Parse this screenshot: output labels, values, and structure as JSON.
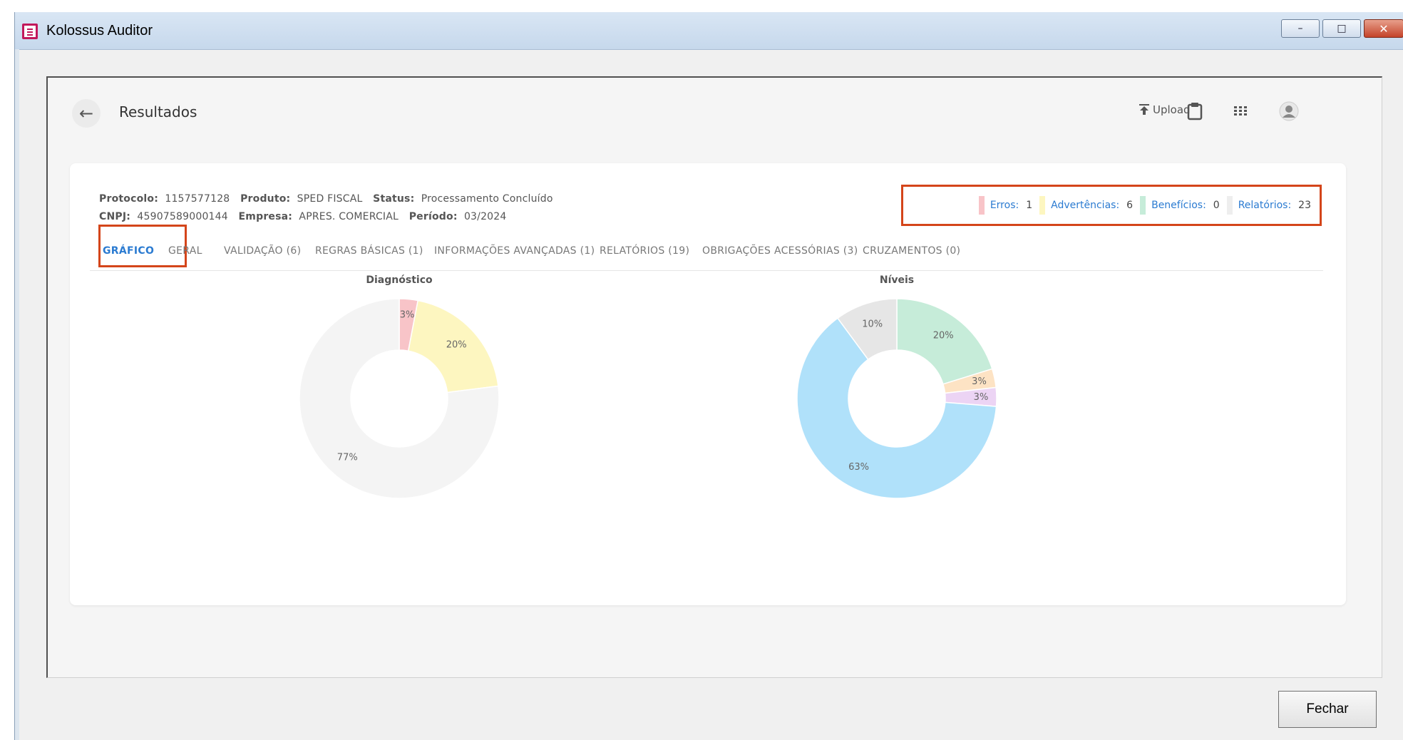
{
  "window": {
    "title": "Kolossus Auditor",
    "minimize_label": "–",
    "maximize_label": "□",
    "close_label": "✕",
    "close_button_label": "Fechar"
  },
  "header": {
    "back_icon": "←",
    "title": "Resultados",
    "upload_label": "Upload"
  },
  "info": {
    "protocolo_label": "Protocolo:",
    "protocolo": "1157577128",
    "produto_label": "Produto:",
    "produto": "SPED FISCAL",
    "status_label": "Status:",
    "status": "Processamento Concluído",
    "cnpj_label": "CNPJ:",
    "cnpj": "45907589000144",
    "empresa_label": "Empresa:",
    "empresa": "APRES. COMERCIAL",
    "periodo_label": "Período:",
    "periodo": "03/2024"
  },
  "summary": [
    {
      "label": "Erros:",
      "value": "1",
      "color": "#f8c4c8"
    },
    {
      "label": "Advertências:",
      "value": "6",
      "color": "#fdf6c0"
    },
    {
      "label": "Benefícios:",
      "value": "0",
      "color": "#c6ecd9"
    },
    {
      "label": "Relatórios:",
      "value": "23",
      "color": "#eeeeee"
    }
  ],
  "tabs": [
    {
      "label": "GRÁFICO",
      "active": true
    },
    {
      "label": "GERAL"
    },
    {
      "label": "VALIDAÇÃO (6)"
    },
    {
      "label": "REGRAS BÁSICAS (1)"
    },
    {
      "label": "INFORMAÇÕES AVANÇADAS (1)"
    },
    {
      "label": "RELATÓRIOS (19)"
    },
    {
      "label": "OBRIGAÇÕES ACESSÓRIAS (3)"
    },
    {
      "label": "CRUZAMENTOS (0)"
    }
  ],
  "chart_data": [
    {
      "type": "pie",
      "title": "Diagnóstico",
      "slices": [
        {
          "label": "3%",
          "value": 3,
          "color": "#f8c4c8"
        },
        {
          "label": "20%",
          "value": 20,
          "color": "#fdf6c0"
        },
        {
          "label": "77%",
          "value": 77,
          "color": "#f4f4f4"
        }
      ]
    },
    {
      "type": "pie",
      "title": "Níveis",
      "slices": [
        {
          "label": "20%",
          "value": 20,
          "color": "#c6ecd9"
        },
        {
          "label": "3%",
          "value": 3,
          "color": "#fde3c4"
        },
        {
          "label": "3%",
          "value": 3,
          "color": "#ecd4f4"
        },
        {
          "label": "63%",
          "value": 63,
          "color": "#b0e1fa"
        },
        {
          "label": "10%",
          "value": 10,
          "color": "#e6e6e6"
        }
      ]
    }
  ]
}
